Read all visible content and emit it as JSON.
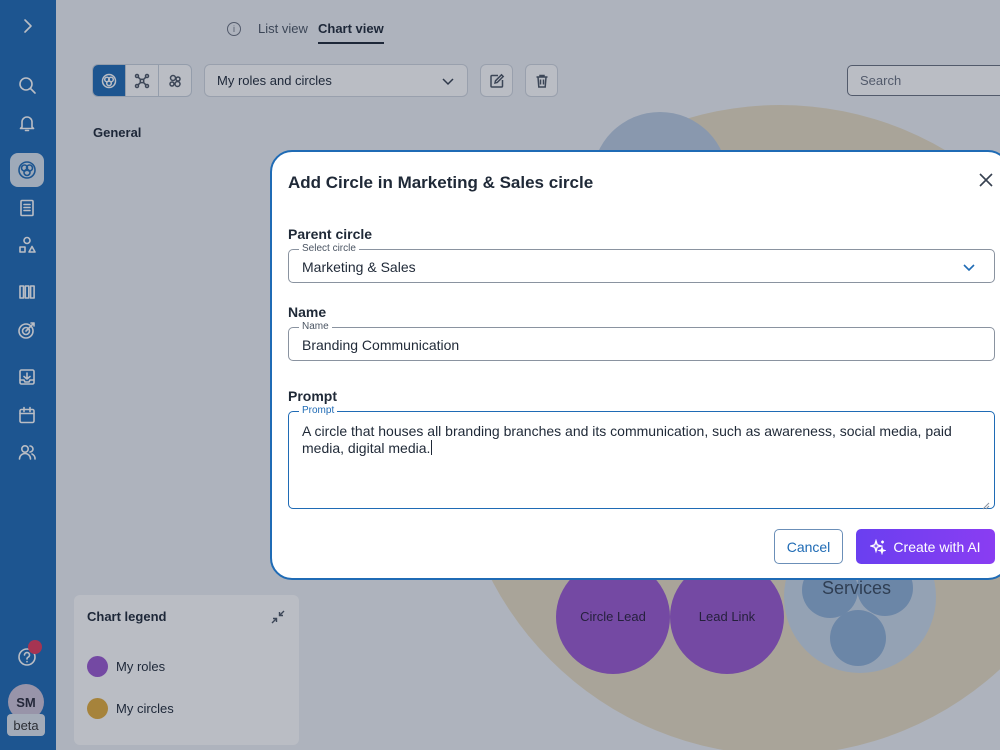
{
  "sidebar": {
    "items": [
      {
        "icon": "chevron-right-icon"
      },
      {
        "icon": "search-icon"
      },
      {
        "icon": "bell-icon"
      },
      {
        "icon": "circles-icon",
        "active": true
      },
      {
        "icon": "document-icon"
      },
      {
        "icon": "shapes-icon"
      },
      {
        "icon": "kanban-icon"
      },
      {
        "icon": "target-icon"
      },
      {
        "icon": "inbox-icon"
      },
      {
        "icon": "calendar-icon"
      },
      {
        "icon": "users-icon"
      },
      {
        "icon": "help-icon"
      }
    ],
    "avatar_initials": "SM",
    "beta_label": "beta"
  },
  "tabs": {
    "list": "List view",
    "chart": "Chart view"
  },
  "toolbar": {
    "view_buttons": [
      "circle-view-icon",
      "network-view-icon",
      "cluster-view-icon"
    ],
    "roles_select_value": "My roles and circles",
    "search_placeholder": "Search"
  },
  "general_label": "General",
  "chart": {
    "bubbles": [
      {
        "label": "Circle Lead",
        "color": "#9b59d0"
      },
      {
        "label": "Lead Link",
        "color": "#9b59d0"
      }
    ],
    "services_label": "Services",
    "services_color": "#8fb1d6",
    "outer_circle_color": "#e7dcc2"
  },
  "legend": {
    "title": "Chart legend",
    "items": [
      {
        "label": "My roles",
        "color": "#9b59d0"
      },
      {
        "label": "My circles",
        "color": "#e3ac3c"
      }
    ]
  },
  "dialog": {
    "title": "Add Circle in Marketing & Sales circle",
    "parent": {
      "section_label": "Parent circle",
      "float_label": "Select circle",
      "value": "Marketing & Sales"
    },
    "name": {
      "section_label": "Name",
      "float_label": "Name",
      "value": "Branding Communication"
    },
    "prompt": {
      "section_label": "Prompt",
      "float_label": "Prompt",
      "value": "A circle that houses all branding branches and its communication, such as awareness, social media, paid media, digital media."
    },
    "cancel_label": "Cancel",
    "create_label": "Create with AI"
  },
  "colors": {
    "accent": "#1f6bb5",
    "ai_gradient_start": "#6a3ff0",
    "ai_gradient_end": "#8a3df2"
  }
}
